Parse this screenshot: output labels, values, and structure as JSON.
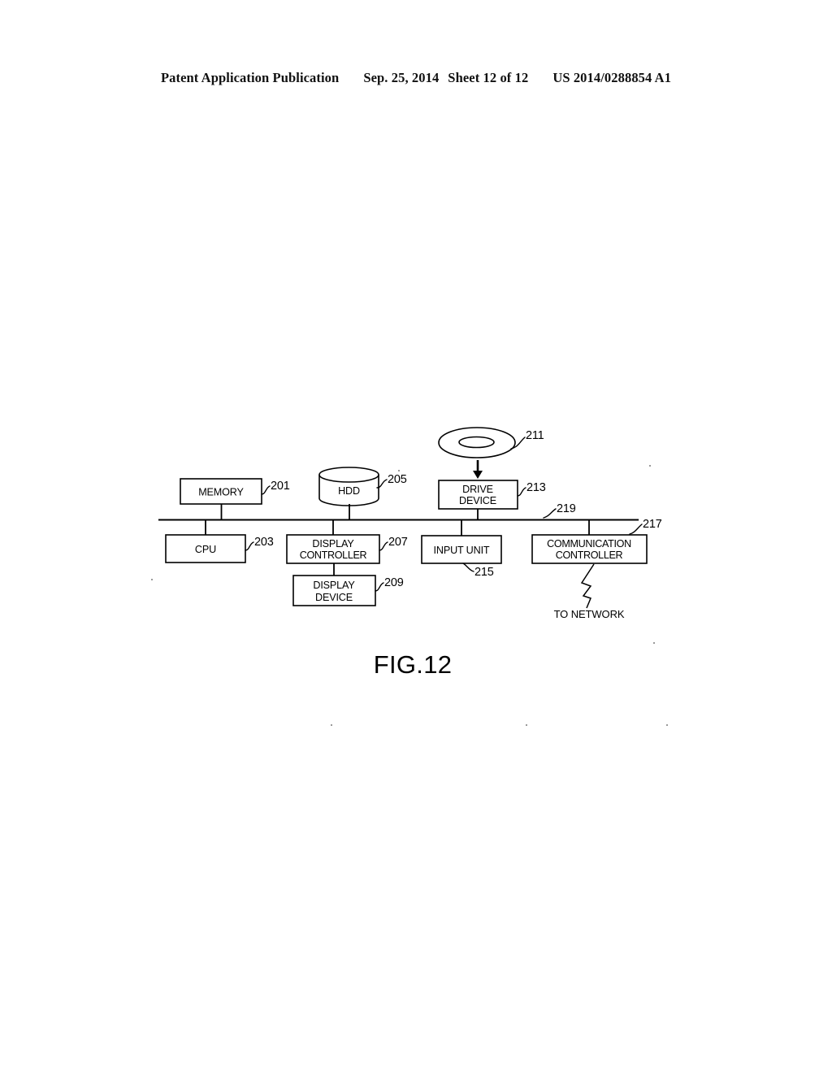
{
  "header": {
    "publication": "Patent Application Publication",
    "date": "Sep. 25, 2014",
    "sheet": "Sheet 12 of 12",
    "patent_number": "US 2014/0288854 A1"
  },
  "figure": {
    "caption": "FIG.12",
    "network_label": "TO NETWORK",
    "blocks": {
      "memory": {
        "label": "MEMORY",
        "ref": "201"
      },
      "cpu": {
        "label": "CPU",
        "ref": "203"
      },
      "hdd": {
        "label": "HDD",
        "ref": "205"
      },
      "display_controller": {
        "label_line1": "DISPLAY",
        "label_line2": "CONTROLLER",
        "ref": "207"
      },
      "display_device": {
        "label_line1": "DISPLAY",
        "label_line2": "DEVICE",
        "ref": "209"
      },
      "removable_disc": {
        "label": "",
        "ref": "211"
      },
      "drive_device": {
        "label_line1": "DRIVE",
        "label_line2": "DEVICE",
        "ref": "213"
      },
      "input_unit": {
        "label": "INPUT UNIT",
        "ref": "215"
      },
      "communication_controller": {
        "label_line1": "COMMUNICATION",
        "label_line2": "CONTROLLER",
        "ref": "217"
      },
      "bus": {
        "label": "",
        "ref": "219"
      }
    }
  },
  "colors": {
    "ink": "#000000",
    "paper": "#ffffff"
  }
}
